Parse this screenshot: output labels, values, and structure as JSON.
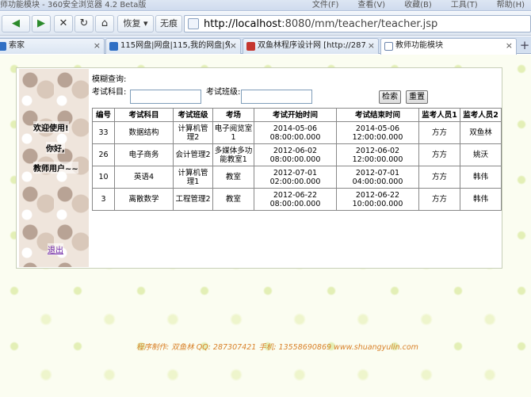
{
  "browser": {
    "window_title": "师功能模块 - 360安全浏览器 4.2 Beta版",
    "menu": [
      "文件(F)",
      "查看(V)",
      "收藏(B)",
      "工具(T)",
      "帮助(H)"
    ],
    "buttons": {
      "back": "◀",
      "forward": "▶",
      "stop": "✕",
      "refresh": "↻",
      "home": "⌂",
      "restore": "恢复",
      "incognito": "无痕"
    },
    "address": {
      "host": "http://localhost",
      "rest": ":8080/mm/teacher/teacher.jsp"
    },
    "tabs": [
      {
        "label": "索家",
        "active": false
      },
      {
        "label": "115网盘|网盘|115,我的网盘|免...",
        "active": false
      },
      {
        "label": "双鱼林程序设计网 [http://287...",
        "active": false
      },
      {
        "label": "教师功能模块",
        "active": true
      }
    ],
    "new_tab": "+"
  },
  "sidebar": {
    "welcome": "欢迎使用!",
    "hello": "你好,",
    "role": "教师用户~~",
    "logout": "退出"
  },
  "search": {
    "title": "模糊查询:",
    "subject_label": "考试科目:",
    "subject_value": "",
    "class_label": "考试班级:",
    "class_value": "",
    "search_button": "检索",
    "reset_button": "重置"
  },
  "table": {
    "headers": [
      "编号",
      "考试科目",
      "考试班级",
      "考场",
      "考试开始时间",
      "考试结束时间",
      "监考人员1",
      "监考人员2"
    ],
    "rows": [
      [
        "33",
        "数据结构",
        "计算机管理2",
        "电子阅览室1",
        "2014-05-06 08:00:00.000",
        "2014-05-06 12:00:00.000",
        "方方",
        "双鱼林"
      ],
      [
        "26",
        "电子商务",
        "会计管理2",
        "多媒体多功能教室1",
        "2012-06-02 08:00:00.000",
        "2012-06-02 12:00:00.000",
        "方方",
        "姚沃"
      ],
      [
        "10",
        "英语4",
        "计算机管理1",
        "教室",
        "2012-07-01 02:00:00.000",
        "2012-07-01 04:00:00.000",
        "方方",
        "韩伟"
      ],
      [
        "3",
        "离散数学",
        "工程管理2",
        "教室",
        "2012-06-22 08:00:00.000",
        "2012-06-22 10:00:00.000",
        "方方",
        "韩伟"
      ]
    ]
  },
  "footer": "程序制作: 双鱼林   QQ: 287307421   手机: 13558690869   www.shuangyulin.com",
  "colors": {
    "footer_text": "#d9822b",
    "logout_link": "#6a1fa3",
    "page_background": "#fbfdf1"
  }
}
